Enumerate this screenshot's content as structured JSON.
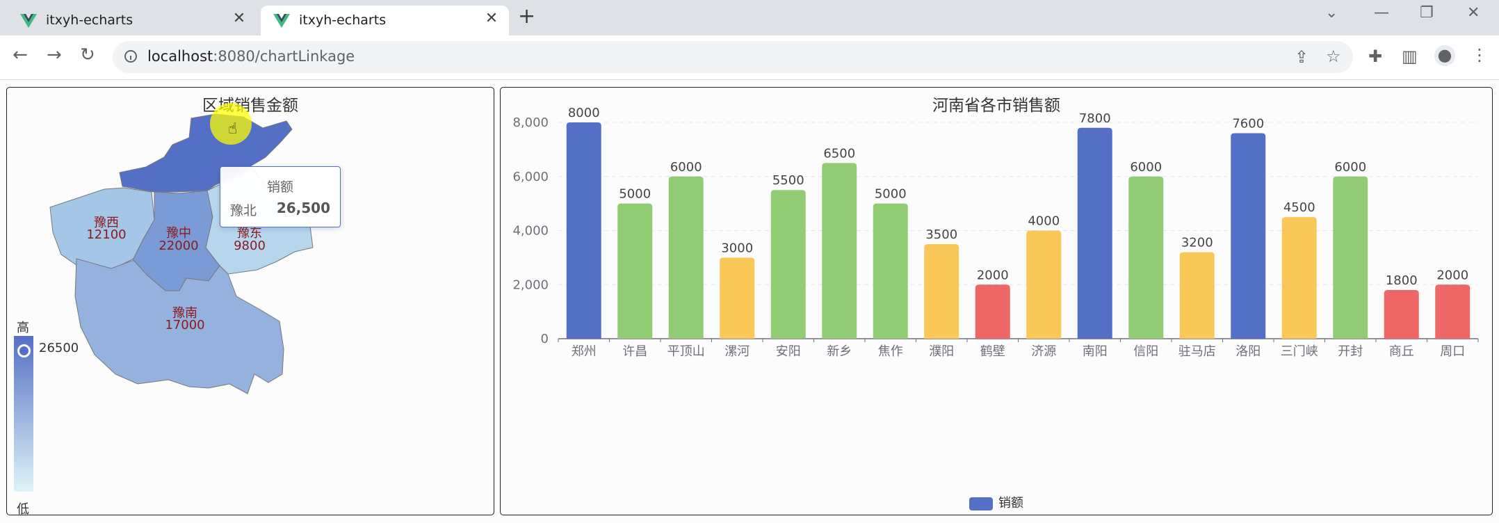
{
  "browser": {
    "tabs": [
      {
        "title": "itxyh-echarts",
        "active": false
      },
      {
        "title": "itxyh-echarts",
        "active": true
      }
    ],
    "url_host": "localhost",
    "url_path": ":8080/chartLinkage"
  },
  "map_chart": {
    "title": "区域销售金额",
    "regions": [
      {
        "name": "豫北",
        "value": "26500"
      },
      {
        "name": "豫西",
        "value": "12100"
      },
      {
        "name": "豫中",
        "value": "22000"
      },
      {
        "name": "豫东",
        "value": "9800"
      },
      {
        "name": "豫南",
        "value": "17000"
      }
    ],
    "visual_map": {
      "high_label": "高",
      "low_label": "低",
      "current_value": "26500",
      "max_color": "#5470c6",
      "min_color": "#e0f3f8"
    },
    "tooltip": {
      "title": "销额",
      "name": "豫北",
      "value": "26,500"
    },
    "label_color": "#8b1a1a"
  },
  "chart_data": {
    "type": "bar",
    "title": "河南省各市销售额",
    "categories": [
      "郑州",
      "许昌",
      "平顶山",
      "漯河",
      "安阳",
      "新乡",
      "焦作",
      "濮阳",
      "鹤壁",
      "济源",
      "南阳",
      "信阳",
      "驻马店",
      "洛阳",
      "三门峡",
      "开封",
      "商丘",
      "周口"
    ],
    "series": [
      {
        "name": "销额",
        "values": [
          8000,
          5000,
          6000,
          3000,
          5500,
          6500,
          5000,
          3500,
          2000,
          4000,
          7800,
          6000,
          3200,
          7600,
          4500,
          6000,
          1800,
          2000
        ]
      }
    ],
    "bar_colors": [
      "#5470c6",
      "#91cc75",
      "#91cc75",
      "#fac858",
      "#91cc75",
      "#91cc75",
      "#91cc75",
      "#fac858",
      "#ee6666",
      "#fac858",
      "#5470c6",
      "#91cc75",
      "#fac858",
      "#5470c6",
      "#fac858",
      "#91cc75",
      "#ee6666",
      "#ee6666"
    ],
    "ylim": [
      0,
      8000
    ],
    "yticks": [
      "0",
      "2,000",
      "4,000",
      "6,000",
      "8,000"
    ],
    "grid": "dashed horizontal",
    "legend": {
      "position": "bottom",
      "label": "销额"
    }
  }
}
